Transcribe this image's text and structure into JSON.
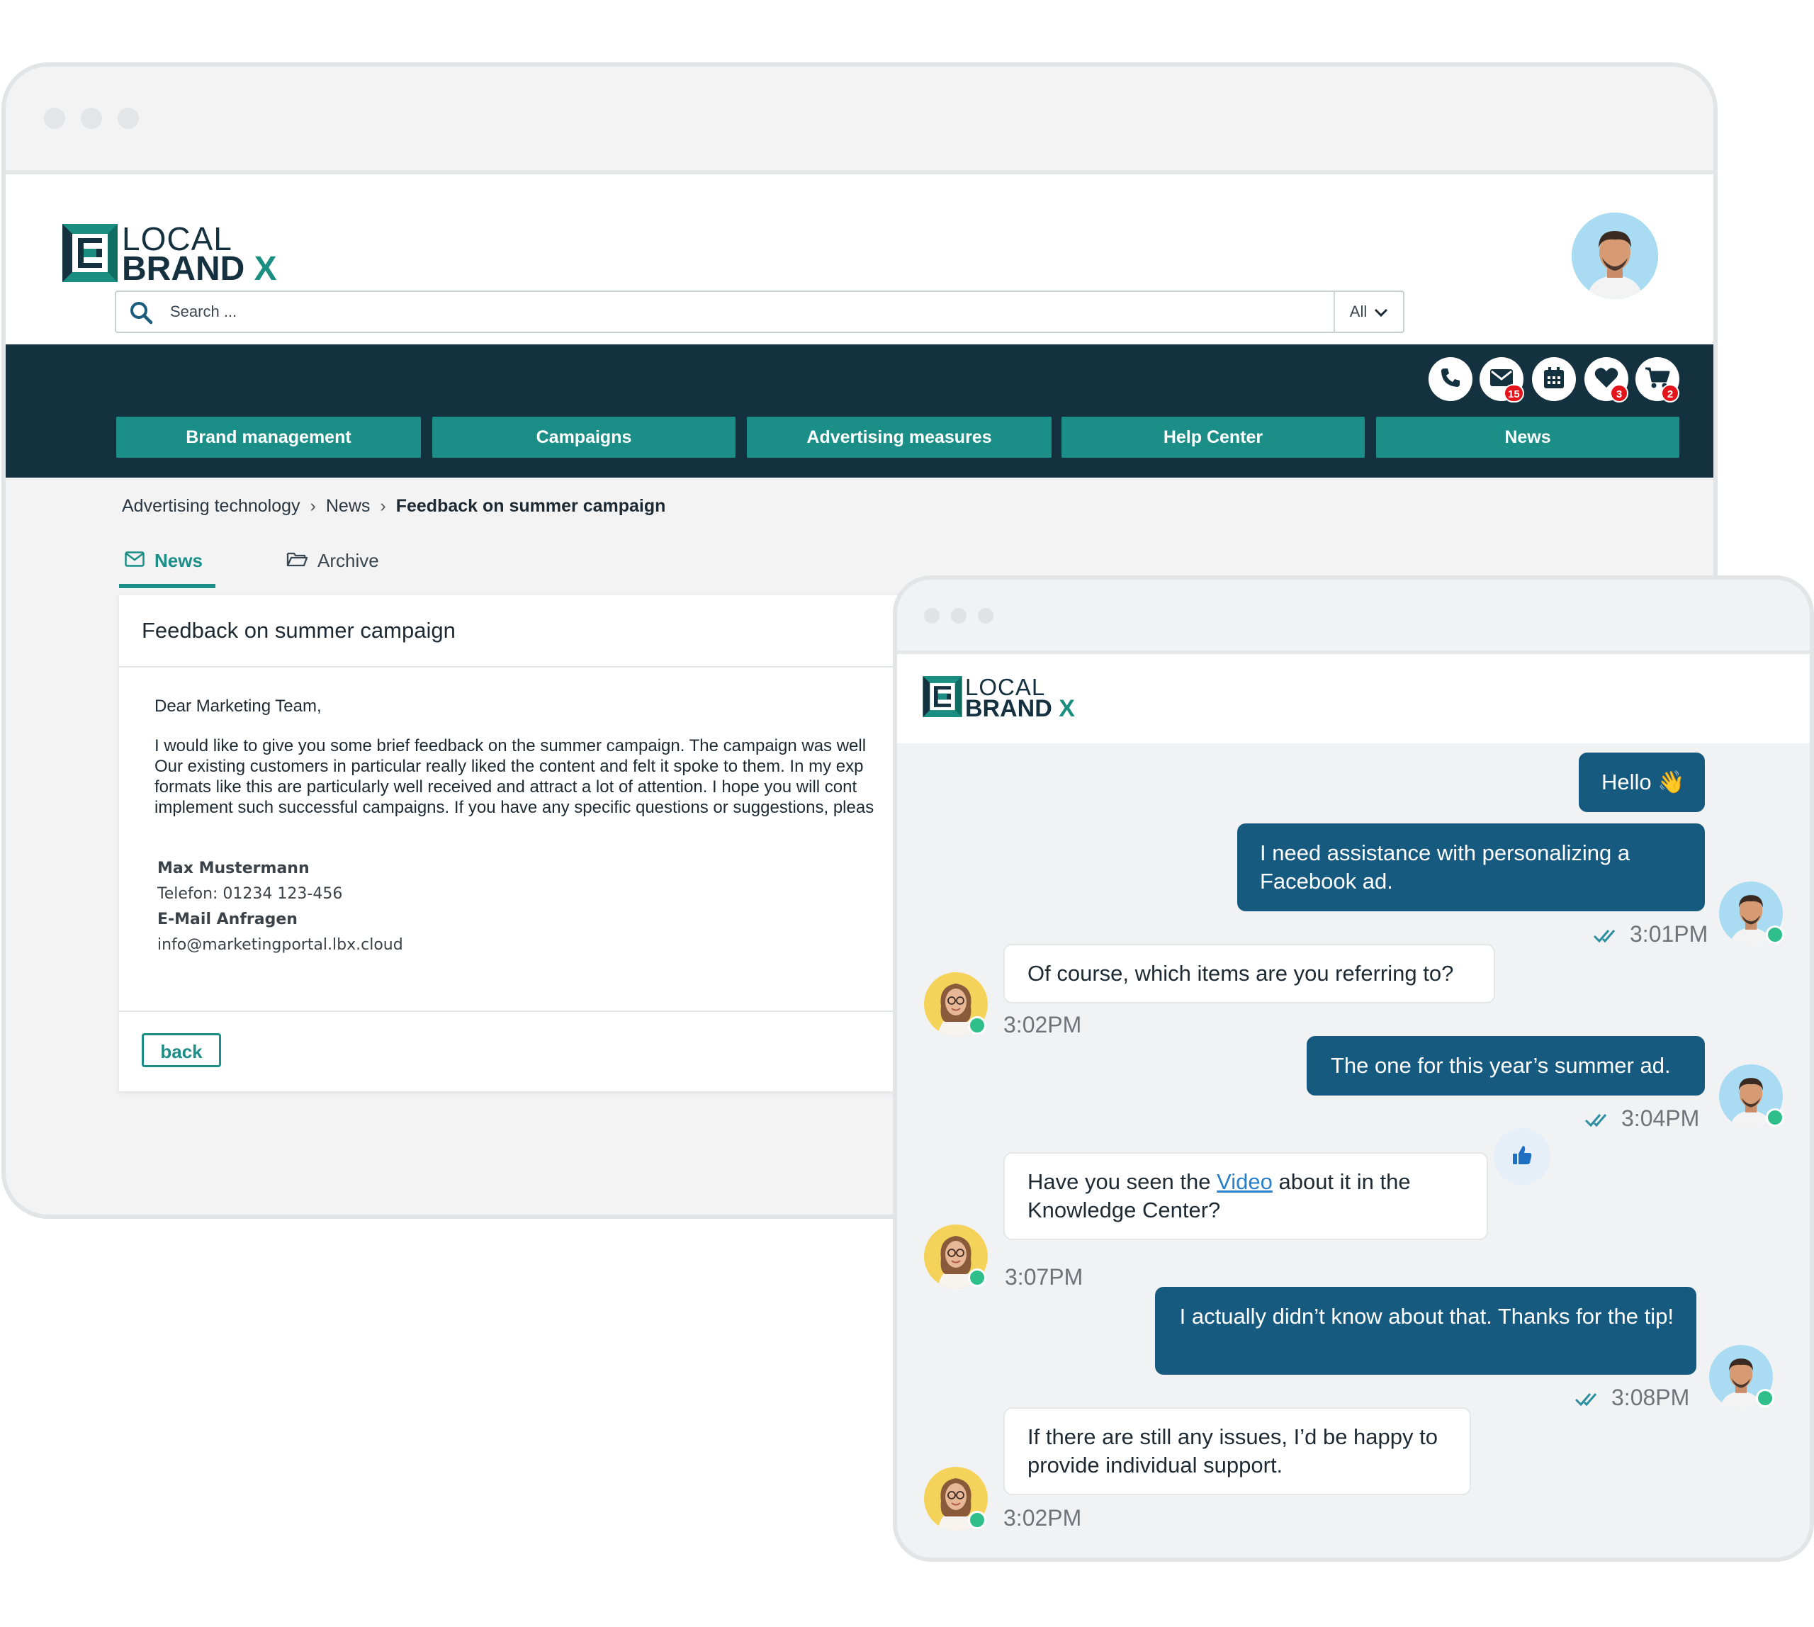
{
  "brand": {
    "logo_top": "LOCAL",
    "logo_bottom": "BRAND",
    "logo_x": "X"
  },
  "search": {
    "placeholder": "Search ...",
    "scope": "All"
  },
  "header_icons": [
    {
      "icon": "phone-icon"
    },
    {
      "icon": "mail-icon",
      "badge": "15"
    },
    {
      "icon": "calendar-icon"
    },
    {
      "icon": "heart-icon",
      "badge": "3"
    },
    {
      "icon": "cart-icon",
      "badge": "2"
    }
  ],
  "nav": {
    "items": [
      "Brand management",
      "Campaigns",
      "Advertising measures",
      "Help Center",
      "News"
    ]
  },
  "breadcrumb": {
    "items": [
      "Advertising technology",
      "News",
      "Feedback on summer campaign"
    ]
  },
  "tabs": [
    {
      "label": "News",
      "icon": "mail-icon",
      "active": true
    },
    {
      "label": "Archive",
      "icon": "folder-icon",
      "active": false
    }
  ],
  "message": {
    "title": "Feedback on summer campaign",
    "greeting": "Dear Marketing Team,",
    "lines": [
      "I would like to give you some brief feedback on the summer campaign. The campaign was well",
      "Our existing customers in particular really liked the content and felt it spoke to them. In my exp",
      "formats like this are particularly well received and attract a lot of attention. I hope you will cont",
      "implement such successful campaigns. If you have any specific questions or suggestions, pleas"
    ],
    "signature": {
      "name": "Max Mustermann",
      "phone": "Telefon: 01234 123-456",
      "email_label": "E-Mail Anfragen",
      "email": "info@marketingportal.lbx.cloud"
    },
    "back_label": "back"
  },
  "chat": {
    "messages": [
      {
        "from": "user",
        "text": "Hello 👋"
      },
      {
        "from": "user",
        "text": "I need assistance with personalizing a Facebook ad.",
        "time": "3:01PM"
      },
      {
        "from": "agent",
        "text": "Of course, which items are you referring to?",
        "time": "3:02PM"
      },
      {
        "from": "user",
        "text": "The one for this year’s summer ad.",
        "time": "3:04PM"
      },
      {
        "from": "agent",
        "text_before": "Have you seen the ",
        "link": "Video",
        "text_after": " about it in the Knowledge Center?",
        "time": "3:07PM",
        "reaction": "thumbs-up-icon"
      },
      {
        "from": "user",
        "text": "I actually didn’t know about that. Thanks for the tip!",
        "time": "3:08PM"
      },
      {
        "from": "agent",
        "text": "If there are still any issues, I’d be happy to provide individual support.",
        "time": "3:02PM"
      }
    ]
  },
  "colors": {
    "navy": "#14313f",
    "teal": "#1a8e87",
    "bubble_out": "#175a80",
    "badge": "#e3151b",
    "online": "#2fbf8d"
  }
}
